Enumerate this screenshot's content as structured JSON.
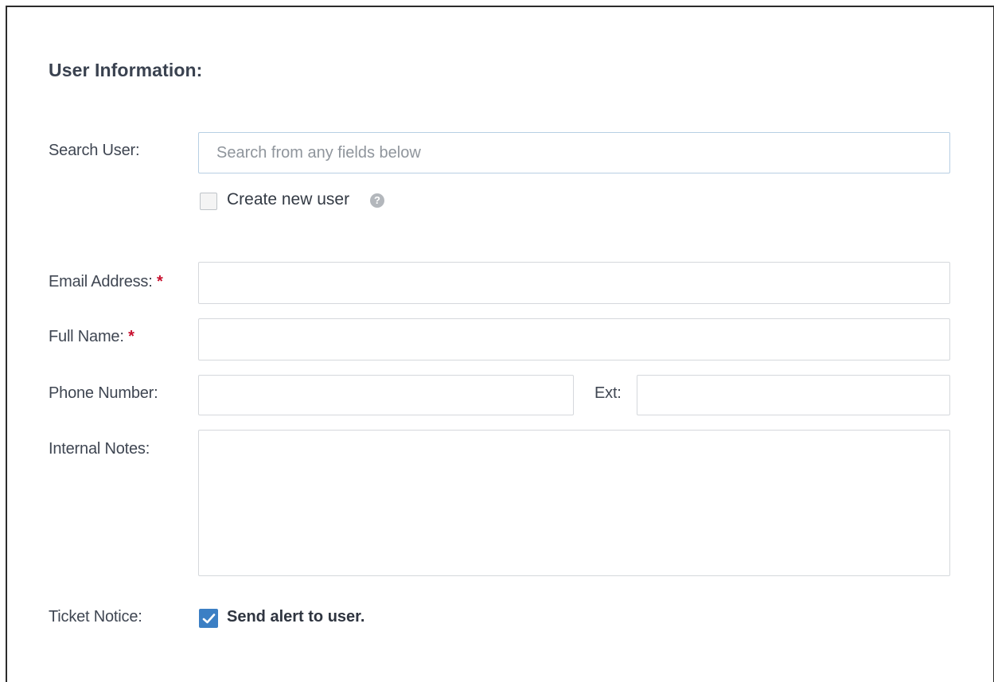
{
  "section": {
    "title": "User Information:"
  },
  "search_user": {
    "label": "Search User:",
    "placeholder": "Search from any fields below",
    "value": ""
  },
  "create_new_user": {
    "label": "Create new user",
    "checked": false,
    "help_icon": "question-circle-icon",
    "help_glyph": "?"
  },
  "email": {
    "label": "Email Address:",
    "required_mark": "*",
    "value": ""
  },
  "full_name": {
    "label": "Full Name:",
    "required_mark": "*",
    "value": ""
  },
  "phone": {
    "label": "Phone Number:",
    "value": "",
    "ext_label": "Ext:",
    "ext_value": ""
  },
  "internal_notes": {
    "label": "Internal Notes:",
    "value": ""
  },
  "ticket_notice": {
    "label": "Ticket Notice:",
    "option_label": "Send alert to user.",
    "checked": true
  },
  "colors": {
    "accent": "#3b7fc4",
    "required": "#c8102e",
    "border": "#d5d8dc"
  }
}
